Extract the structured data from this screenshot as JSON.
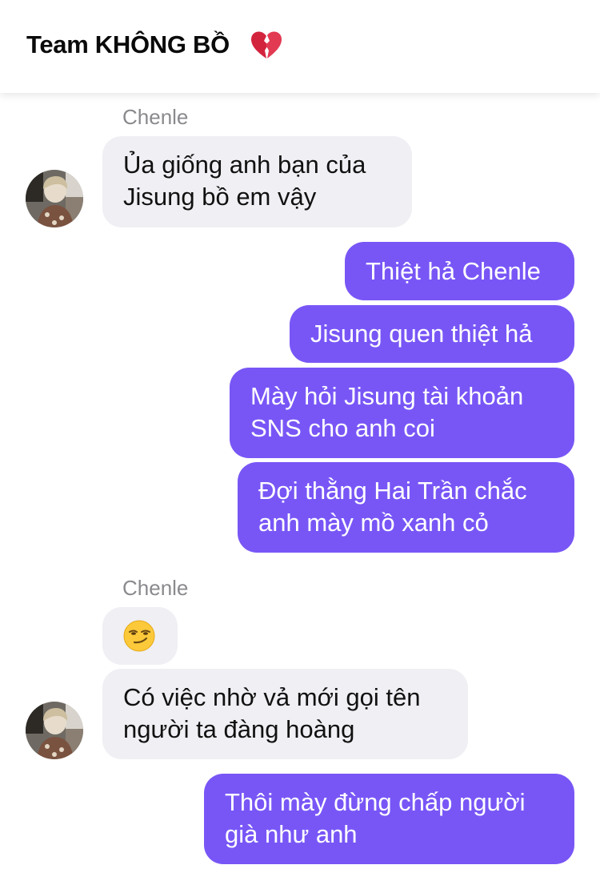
{
  "header": {
    "title": "Team KHÔNG BỒ",
    "title_emoji": "broken-heart-icon"
  },
  "messages": {
    "m1_sender": "Chenle",
    "m1_line1": "Ủa giống anh bạn của",
    "m1_line2": "Jisung bồ em vậy",
    "m2": "Thiệt hả Chenle",
    "m3": "Jisung quen thiệt hả",
    "m4_line1": "Mày hỏi Jisung tài khoản",
    "m4_line2": "SNS cho anh coi",
    "m5_line1": "Đợi thằng Hai Trần chắc",
    "m5_line2": "anh mày mồ xanh cỏ",
    "m6_sender": "Chenle",
    "m6_emoji": "smirking-face-icon",
    "m7_line1": "Có việc nhờ vả mới gọi tên",
    "m7_line2": "người ta đàng hoàng",
    "m8_line1": "Thôi mày đừng chấp người",
    "m8_line2": "già như anh"
  },
  "colors": {
    "outgoing_bubble": "#7856f6",
    "incoming_bubble": "#efeff4",
    "sender_name": "#8a8a8e"
  }
}
